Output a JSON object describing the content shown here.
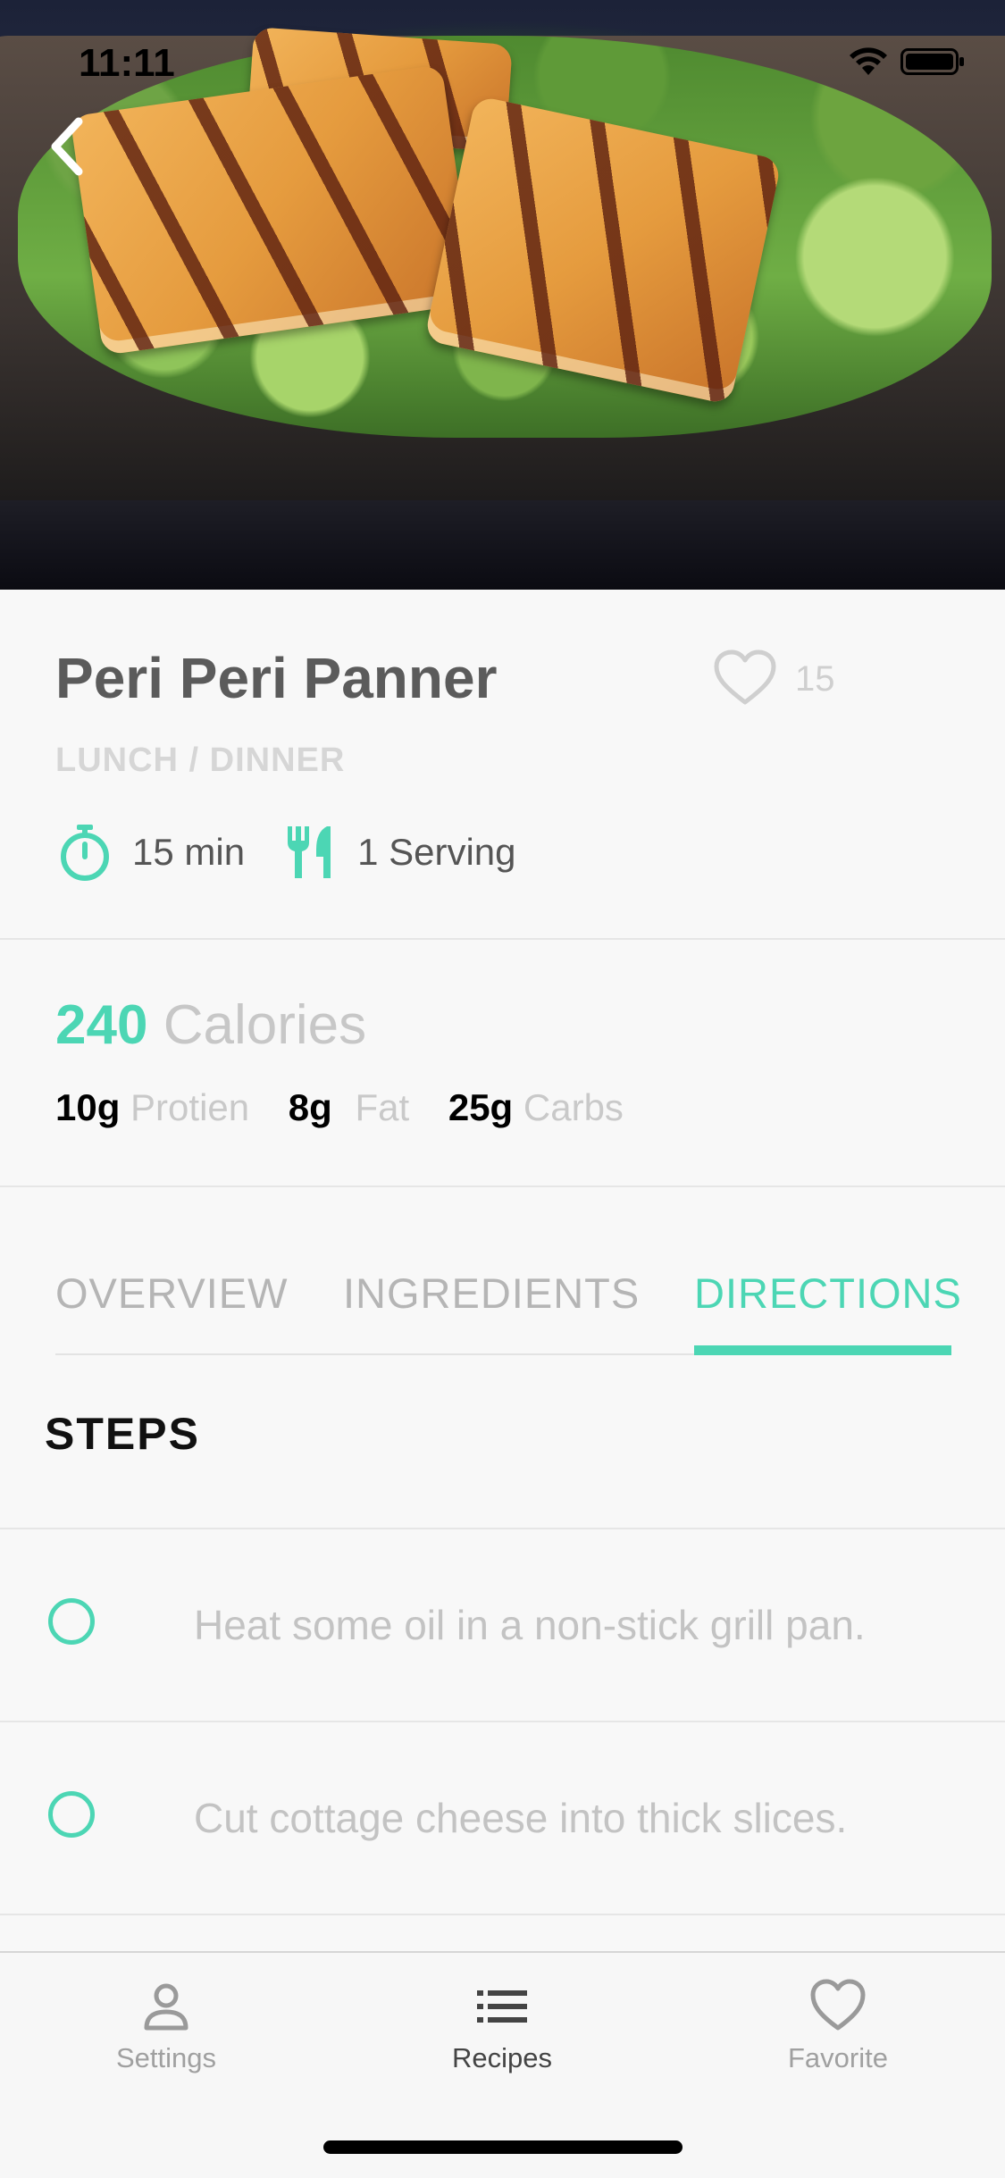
{
  "status": {
    "time": "11:11"
  },
  "recipe": {
    "title": "Peri Peri Panner",
    "likes": "15",
    "category": "LUNCH  / DINNER",
    "time": "15 min",
    "servings": "1 Serving"
  },
  "nutrition": {
    "calories_value": "240",
    "calories_label": "Calories",
    "macros": [
      {
        "value": "10g",
        "label": "Protien"
      },
      {
        "value": "8g",
        "label": "Fat"
      },
      {
        "value": "25g",
        "label": "Carbs"
      }
    ]
  },
  "tabs": [
    {
      "label": "OVERVIEW",
      "active": false
    },
    {
      "label": "INGREDIENTS",
      "active": false
    },
    {
      "label": "DIRECTIONS",
      "active": true
    }
  ],
  "steps": {
    "heading": "STEPS",
    "items": [
      "Heat some oil in a non-stick grill pan.",
      "Cut cottage cheese  into thick slices."
    ]
  },
  "tabbar": {
    "items": [
      {
        "label": "Settings",
        "icon": "person-icon",
        "active": false
      },
      {
        "label": "Recipes",
        "icon": "list-icon",
        "active": true
      },
      {
        "label": "Favorite",
        "icon": "heart-icon",
        "active": false
      }
    ]
  },
  "colors": {
    "accent": "#4cd6b4"
  }
}
